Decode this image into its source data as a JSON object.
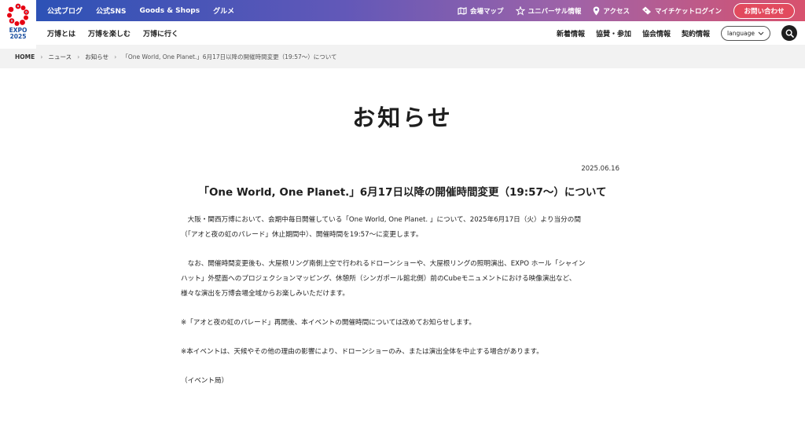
{
  "logo": {
    "line1": "EXPO",
    "line2": "2025"
  },
  "topnav": {
    "left": [
      "公式ブログ",
      "公式SNS",
      "Goods & Shops",
      "グルメ"
    ],
    "map": "会場マップ",
    "universal": "ユニバーサル情報",
    "access": "アクセス",
    "ticket": "マイチケットログイン",
    "contact": "お問い合わせ"
  },
  "subnav": {
    "left": [
      "万博とは",
      "万博を楽しむ",
      "万博に行く"
    ],
    "right": [
      "新着情報",
      "協賛・参加",
      "協会情報",
      "契約情報"
    ],
    "language": "language"
  },
  "breadcrumb": {
    "home": "HOME",
    "news": "ニュース",
    "notice": "お知らせ",
    "current": "「One World, One Planet.」6月17日以降の開催時間変更（19:57～）について"
  },
  "page": {
    "title": "お知らせ",
    "date": "2025.06.16",
    "article_title": "「One World, One Planet.」6月17日以降の開催時間変更（19:57～）について",
    "p1_l1": "　大阪・関西万博において、会期中毎日開催している「One World, One Planet. 」について、2025年6月17日（火）より当分の間",
    "p1_l2": "（「アオと夜の虹のパレード」休止期間中）、開催時間を19:57～に変更します。",
    "p2_l1": "　なお、開催時間変更後も、大屋根リング南側上空で行われるドローンショーや、大屋根リングの照明演出、EXPO ホール「シャイン",
    "p2_l2": "ハット」外壁面へのプロジェクションマッピング、休憩所（シンガポール館北側）前のCubeモニュメントにおける映像演出など、",
    "p2_l3": "様々な演出を万博会場全域からお楽しみいただけます。",
    "p3": "※「アオと夜の虹のパレード」再開後、本イベントの開催時間については改めてお知らせします。",
    "p4": "※本イベントは、天候やその他の理由の影響により、ドローンショーのみ、または演出全体を中止する場合があります。",
    "p5": "（イベント局）"
  },
  "colors": {
    "accent": "#e24a5e",
    "brand_blue": "#2d52b6",
    "logo_red": "#e60012"
  }
}
